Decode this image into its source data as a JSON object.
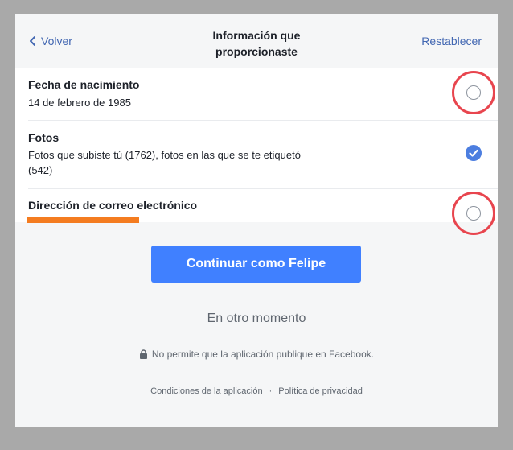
{
  "header": {
    "back_label": "Volver",
    "title": "Información que proporcionaste",
    "reset_label": "Restablecer"
  },
  "permissions": [
    {
      "label": "Fecha de nacimiento",
      "value": "14 de febrero de 1985",
      "checked": false
    },
    {
      "label": "Fotos",
      "value": "Fotos que subiste tú (1762), fotos en las que se te etiquetó (542)",
      "checked": true
    },
    {
      "label": "Dirección de correo electrónico",
      "value": "",
      "checked": false
    }
  ],
  "continue_label": "Continuar como Felipe",
  "later_label": "En otro momento",
  "notice": "No permite que la aplicación publique en Facebook.",
  "footer": {
    "terms": "Condiciones de la aplicación",
    "separator": "·",
    "privacy": "Política de privacidad"
  },
  "colors": {
    "accent": "#4080ff",
    "link": "#4267b2",
    "checkbox": "#4c7ee0",
    "highlight": "#e8454e",
    "redaction": "#f47c20"
  }
}
